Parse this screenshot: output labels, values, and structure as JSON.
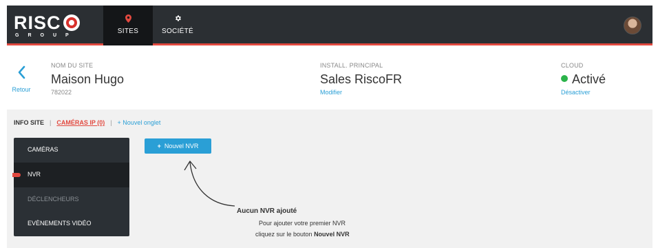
{
  "brand": {
    "name": "RISC",
    "sub": "GROUP"
  },
  "nav": {
    "items": [
      {
        "label": "SITES",
        "icon": "map-pin-icon",
        "active": true
      },
      {
        "label": "SOCIÉTÉ",
        "icon": "gear-icon",
        "active": false
      }
    ]
  },
  "colors": {
    "accent": "#e2493f",
    "link": "#2a9fd6",
    "topbar": "#2b2f33",
    "status_ok": "#2bb34a"
  },
  "header": {
    "back_label": "Retour",
    "site": {
      "label": "NOM DU SITE",
      "value": "Maison Hugo",
      "id": "782022"
    },
    "install": {
      "label": "INSTALL. PRINCIPAL",
      "value": "Sales RiscoFR",
      "link": "Modifier"
    },
    "cloud": {
      "label": "CLOUD",
      "value": "Activé",
      "link": "Désactiver"
    }
  },
  "tabs": {
    "info": "INFO SITE",
    "sep": "|",
    "cameras": "CAMÉRAS IP (0)",
    "new_tab": "+ Nouvel onglet"
  },
  "menu": {
    "items": [
      {
        "label": "CAMÉRAS",
        "state": "normal"
      },
      {
        "label": "NVR",
        "state": "active"
      },
      {
        "label": "DÉCLENCHEURS",
        "state": "disabled"
      },
      {
        "label": "EVÈNEMENTS VIDÉO",
        "state": "normal"
      }
    ]
  },
  "main": {
    "add_button": {
      "plus": "+",
      "label": "Nouvel NVR"
    },
    "empty": {
      "title": "Aucun NVR ajouté",
      "line1": "Pour ajouter votre premier NVR",
      "line2_prefix": "cliquez sur le bouton ",
      "line2_bold": "Nouvel NVR"
    }
  }
}
